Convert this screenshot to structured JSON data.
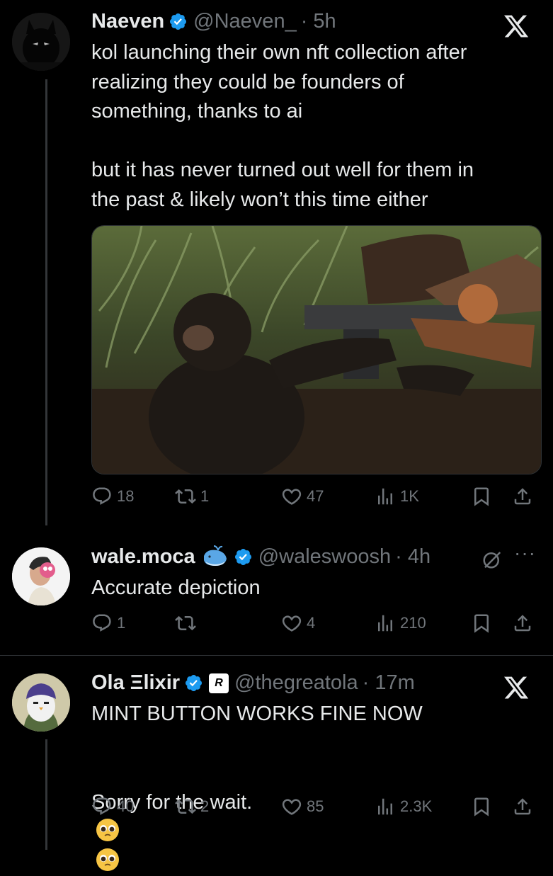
{
  "tweets": [
    {
      "name": "Naeven",
      "handle": "@Naeven_",
      "time": "· 5h",
      "text": "kol launching their own nft collection after\nrealizing they could be founders of\nsomething, thanks to ai\n\nbut it has never turned out well for them in\nthe past & likely won’t this time either",
      "replies": "18",
      "reposts": "1",
      "likes": "47",
      "views": "1K"
    },
    {
      "name": "wale.moca",
      "handle": "@waleswoosh",
      "time": "· 4h",
      "text": "Accurate depiction",
      "replies": "1",
      "reposts": "",
      "likes": "4",
      "views": "210"
    },
    {
      "name": "Ola Ξlixir",
      "handle": "@thegreatola",
      "time": "· 17m",
      "text_line1": "MINT BUTTON WORKS FINE NOW",
      "text_line2": "Sorry for the wait.",
      "replies": "40",
      "reposts": "2",
      "likes": "85",
      "views": "2.3K"
    }
  ],
  "icons": {
    "verified": "verified-badge-icon",
    "x_logo": "x-logo-icon",
    "reply": "reply-icon",
    "repost": "repost-icon",
    "like": "heart-icon",
    "views": "views-icon",
    "bookmark": "bookmark-icon",
    "share": "share-icon"
  },
  "colors": {
    "background": "#000000",
    "text": "#e7e9ea",
    "secondary": "#71767b",
    "verified": "#1d9bf0"
  }
}
